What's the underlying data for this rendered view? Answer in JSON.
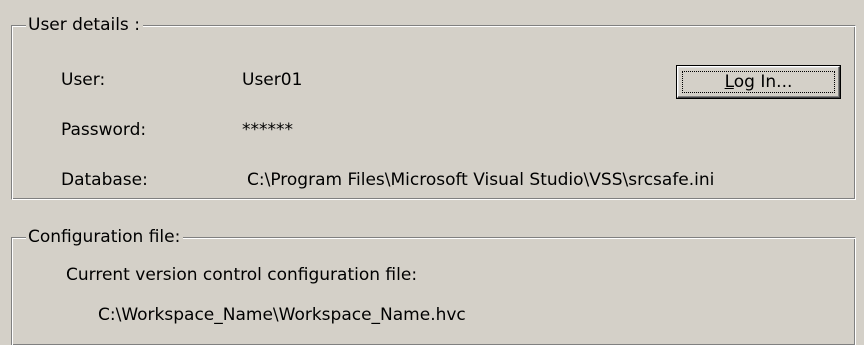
{
  "user_details": {
    "title": "User details :",
    "user_label": "User:",
    "user_value": "User01",
    "password_label": "Password:",
    "password_value": "******",
    "database_label": "Database:",
    "database_value": "C:\\Program Files\\Microsoft Visual Studio\\VSS\\srcsafe.ini",
    "login_button": {
      "mnemonic": "L",
      "rest": "og In..."
    }
  },
  "configuration_file": {
    "title": "Configuration file:",
    "description": "Current version control configuration file:",
    "path": "C:\\Workspace_Name\\Workspace_Name.hvc"
  }
}
